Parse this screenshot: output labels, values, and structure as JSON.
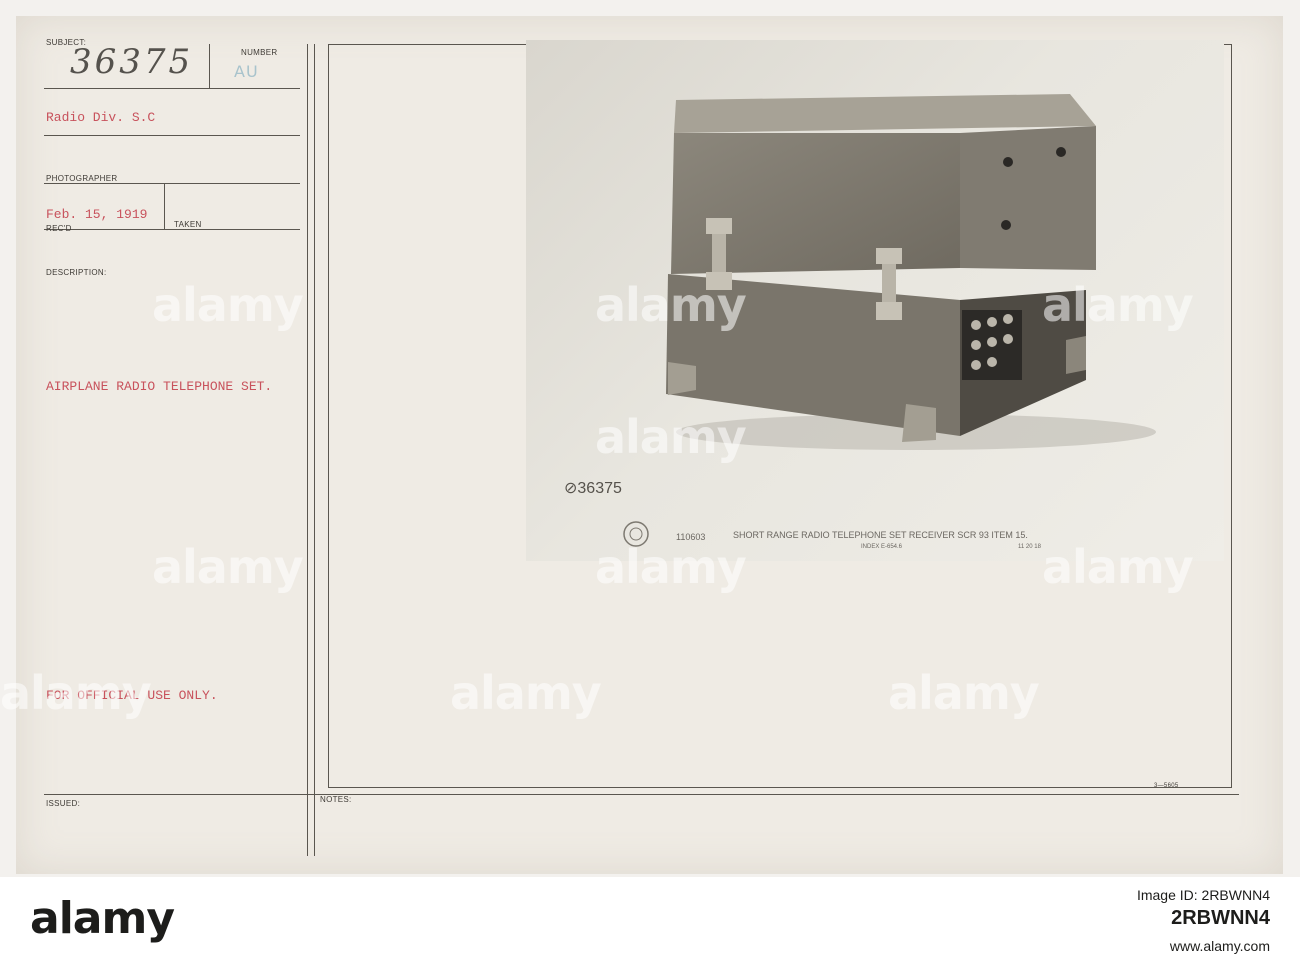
{
  "card": {
    "subject_label": "SUBJECT:",
    "subject_number_handwritten": "36375",
    "number_label": "NUMBER",
    "number_stamp": "AU",
    "division": "Radio Div. S.C",
    "photographer_label": "PHOTOGRAPHER",
    "received_date": "Feb. 15, 1919",
    "recd_label": "REC'D",
    "taken_label": "TAKEN",
    "description_label": "DESCRIPTION:",
    "description": "AIRPLANE RADIO TELEPHONE SET.",
    "restriction": "FOR OFFICIAL USE ONLY.",
    "issued_label": "ISSUED:",
    "notes_label": "NOTES:",
    "form_code": "3—5605"
  },
  "photo": {
    "negative_number": "⊘36375",
    "caption_number": "110603",
    "caption": "SHORT RANGE RADIO TELEPHONE SET RECEIVER SCR 93 ITEM 15.",
    "index": "INDEX E-654.6",
    "date": "11 20 18"
  },
  "watermark": {
    "text": "alamy",
    "letter": "a"
  },
  "footer": {
    "logo": "alamy",
    "image_id_label": "Image ID: 2RBWNN4",
    "image_id": "2RBWNN4",
    "url": "www.alamy.com"
  },
  "colors": {
    "typed_red": "#c8525c",
    "stamp_blue": "#a8c3cc",
    "footer_bg": "#ffffff"
  }
}
